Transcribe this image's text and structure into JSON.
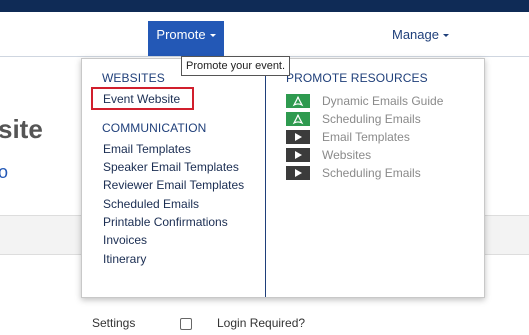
{
  "nav": {
    "promote_label": "Promote",
    "manage_label": "Manage"
  },
  "tooltip": {
    "text": "Promote your event."
  },
  "background": {
    "title_fragment": "site",
    "subtitle_fragment": "o",
    "settings_label": "Settings",
    "login_required_label": "Login Required?"
  },
  "dropdown": {
    "websites": {
      "heading": "WEBSITES",
      "items": [
        "Event Website"
      ]
    },
    "communication": {
      "heading": "COMMUNICATION",
      "items": [
        "Email Templates",
        "Speaker Email Templates",
        "Reviewer Email Templates",
        "Scheduled Emails",
        "Printable Confirmations",
        "Invoices",
        "Itinerary"
      ]
    },
    "resources": {
      "heading": "PROMOTE RESOURCES",
      "items": [
        {
          "label": "Dynamic Emails Guide",
          "icon": "pdf-icon"
        },
        {
          "label": "Scheduling Emails",
          "icon": "pdf-icon"
        },
        {
          "label": "Email Templates",
          "icon": "video-play-icon"
        },
        {
          "label": "Websites",
          "icon": "video-play-icon"
        },
        {
          "label": "Scheduling Emails",
          "icon": "video-play-icon"
        }
      ]
    }
  },
  "colors": {
    "nav_dark": "#0f2b56",
    "promote_active": "#2358b6",
    "highlight_red": "#d11f2d",
    "pdf_green": "#2e9a4f",
    "video_dark": "#3b3b3b"
  }
}
